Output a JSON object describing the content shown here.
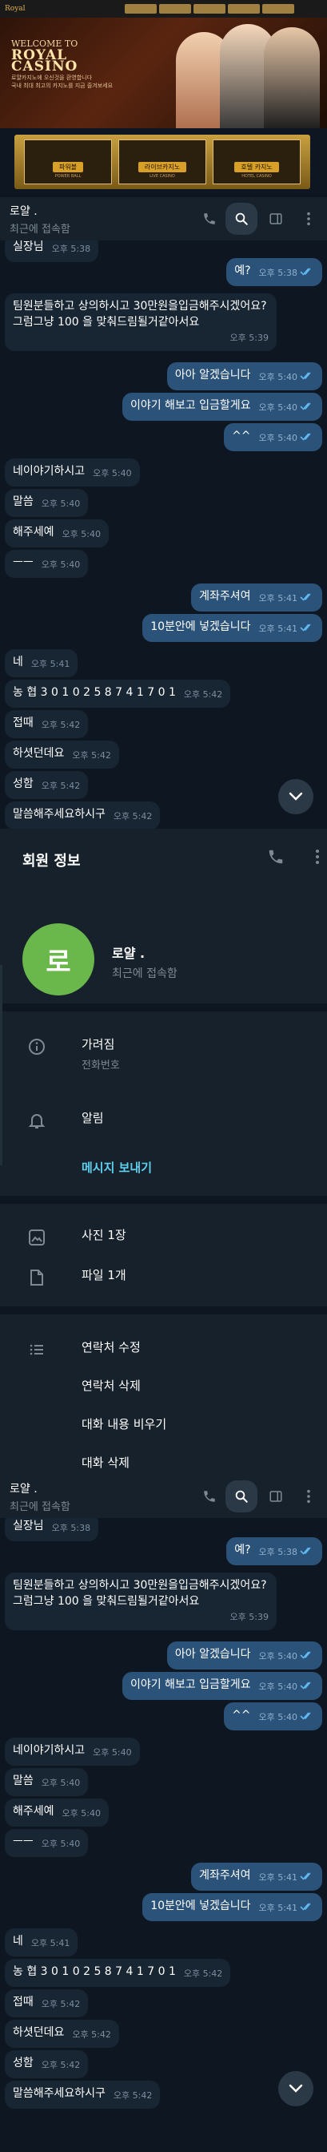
{
  "banner": {
    "logo": "Royal",
    "hero_line1": "WELCOME TO",
    "hero_line2": "ROYAL CASINO",
    "hero_sub1": "로얄카지노에 오신것을 환영합니다",
    "hero_sub2": "국내 최대 최고의 카지노를 지금 즐겨보세요",
    "cards": [
      {
        "label": "파워볼",
        "sub": "POWER BALL"
      },
      {
        "label": "라이브카지노",
        "sub": "LIVE CASINO"
      },
      {
        "label": "호텔 카지노",
        "sub": "HOTEL CASINO"
      }
    ]
  },
  "chat_header": {
    "name": "로얄 .",
    "status": "최근에 접속함"
  },
  "messages": [
    {
      "dir": "in",
      "text": "실장님",
      "time": "오후 5:38"
    },
    {
      "dir": "out",
      "text": "예?",
      "time": "오후 5:38"
    },
    {
      "dir": "in",
      "text": "팀원분들하고 상의하시고 30만원을입금해주시겠어요?그럼그냥 100 을 맞춰드림될거같아서요",
      "time": "오후 5:39"
    },
    {
      "dir": "out",
      "text": "아아 알겠습니다",
      "time": "오후 5:40"
    },
    {
      "dir": "out",
      "text": "이야기 해보고 입금할게요",
      "time": "오후 5:40"
    },
    {
      "dir": "out",
      "text": "^^",
      "time": "오후 5:40"
    },
    {
      "dir": "in",
      "text": "네이야기하시고",
      "time": "오후 5:40"
    },
    {
      "dir": "in",
      "text": "말씀",
      "time": "오후 5:40"
    },
    {
      "dir": "in",
      "text": "해주세예",
      "time": "오후 5:40"
    },
    {
      "dir": "in",
      "text": "ㅡㅡ",
      "time": "오후 5:40"
    },
    {
      "dir": "out",
      "text": "계좌주셔여",
      "time": "오후 5:41"
    },
    {
      "dir": "out",
      "text": "10분안에 넣겠습니다",
      "time": "오후 5:41"
    },
    {
      "dir": "in",
      "text": "네",
      "time": "오후 5:41"
    },
    {
      "dir": "in",
      "text": "농 협 3 0 1 0 2 5 8 7 4 1 7 0 1",
      "time": "오후 5:42"
    },
    {
      "dir": "in",
      "text": "접때",
      "time": "오후 5:42"
    },
    {
      "dir": "in",
      "text": "하셧던데요",
      "time": "오후 5:42"
    },
    {
      "dir": "in",
      "text": "성함",
      "time": "오후 5:42"
    },
    {
      "dir": "in",
      "text": "말씀해주세요하시구",
      "time": "오후 5:42"
    }
  ],
  "profile": {
    "title": "회원 정보",
    "avatar_letter": "로",
    "name": "로얄 .",
    "status": "최근에 접속함",
    "phone_label": "가려짐",
    "phone_sub": "전화번호",
    "notifications": "알림",
    "send_message": "메시지 보내기",
    "photos": "사진 1장",
    "files": "파일 1개",
    "edit_contact": "연락처 수정",
    "delete_contact": "연락처 삭제",
    "clear_history": "대화 내용 비우기",
    "delete_chat": "대화 삭제"
  },
  "colors": {
    "background": "#0e1621",
    "panel": "#17212b",
    "incoming_bubble": "#182533",
    "outgoing_bubble": "#2b5278",
    "read_check": "#5fb8f0",
    "avatar": "#6ab84b",
    "accent": "#5ed0f0"
  }
}
